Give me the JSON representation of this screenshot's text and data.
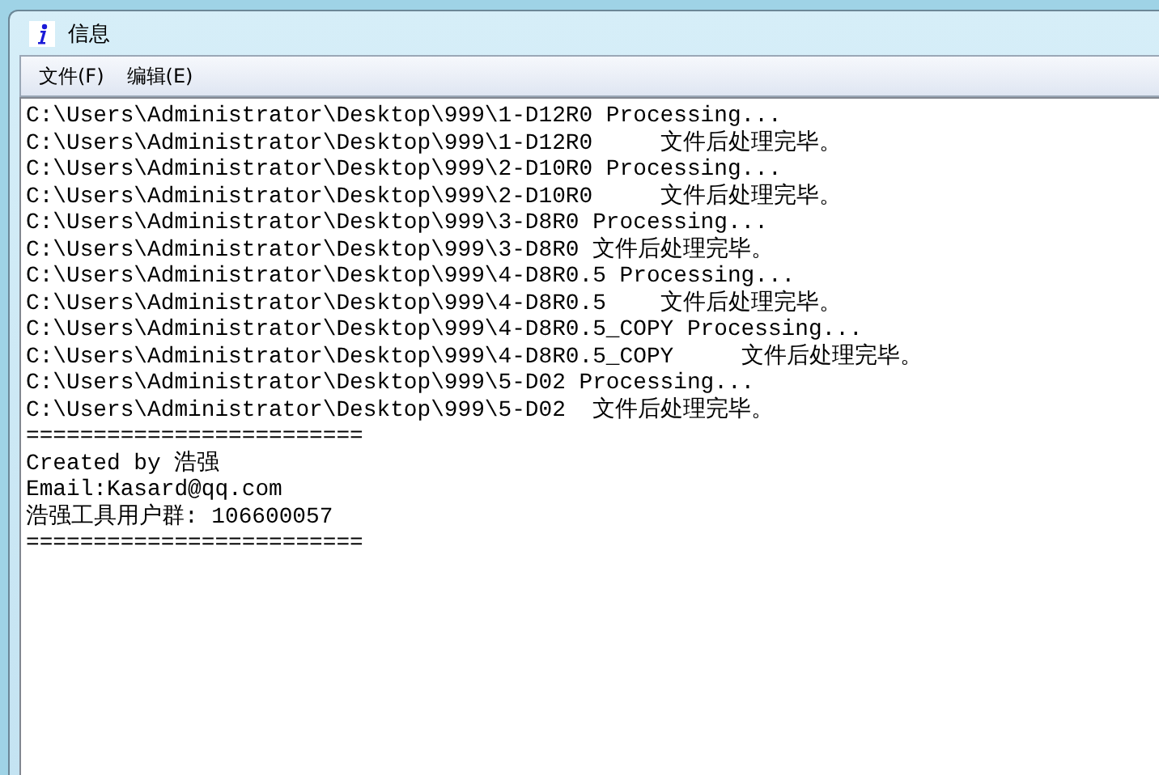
{
  "window": {
    "title": "信息"
  },
  "menu": [
    {
      "label": "文件(F)"
    },
    {
      "label": "编辑(E)"
    }
  ],
  "log": {
    "lines": [
      "C:\\Users\\Administrator\\Desktop\\999\\1-D12R0 Processing...",
      "C:\\Users\\Administrator\\Desktop\\999\\1-D12R0     文件后处理完毕。",
      "C:\\Users\\Administrator\\Desktop\\999\\2-D10R0 Processing...",
      "C:\\Users\\Administrator\\Desktop\\999\\2-D10R0     文件后处理完毕。",
      "C:\\Users\\Administrator\\Desktop\\999\\3-D8R0 Processing...",
      "C:\\Users\\Administrator\\Desktop\\999\\3-D8R0 文件后处理完毕。",
      "C:\\Users\\Administrator\\Desktop\\999\\4-D8R0.5 Processing...",
      "C:\\Users\\Administrator\\Desktop\\999\\4-D8R0.5    文件后处理完毕。",
      "C:\\Users\\Administrator\\Desktop\\999\\4-D8R0.5_COPY Processing...",
      "C:\\Users\\Administrator\\Desktop\\999\\4-D8R0.5_COPY     文件后处理完毕。",
      "C:\\Users\\Administrator\\Desktop\\999\\5-D02 Processing...",
      "C:\\Users\\Administrator\\Desktop\\999\\5-D02  文件后处理完毕。",
      "=========================",
      "Created by 浩强",
      "Email:Kasard@qq.com",
      "浩强工具用户群: 106600057",
      "========================="
    ]
  }
}
